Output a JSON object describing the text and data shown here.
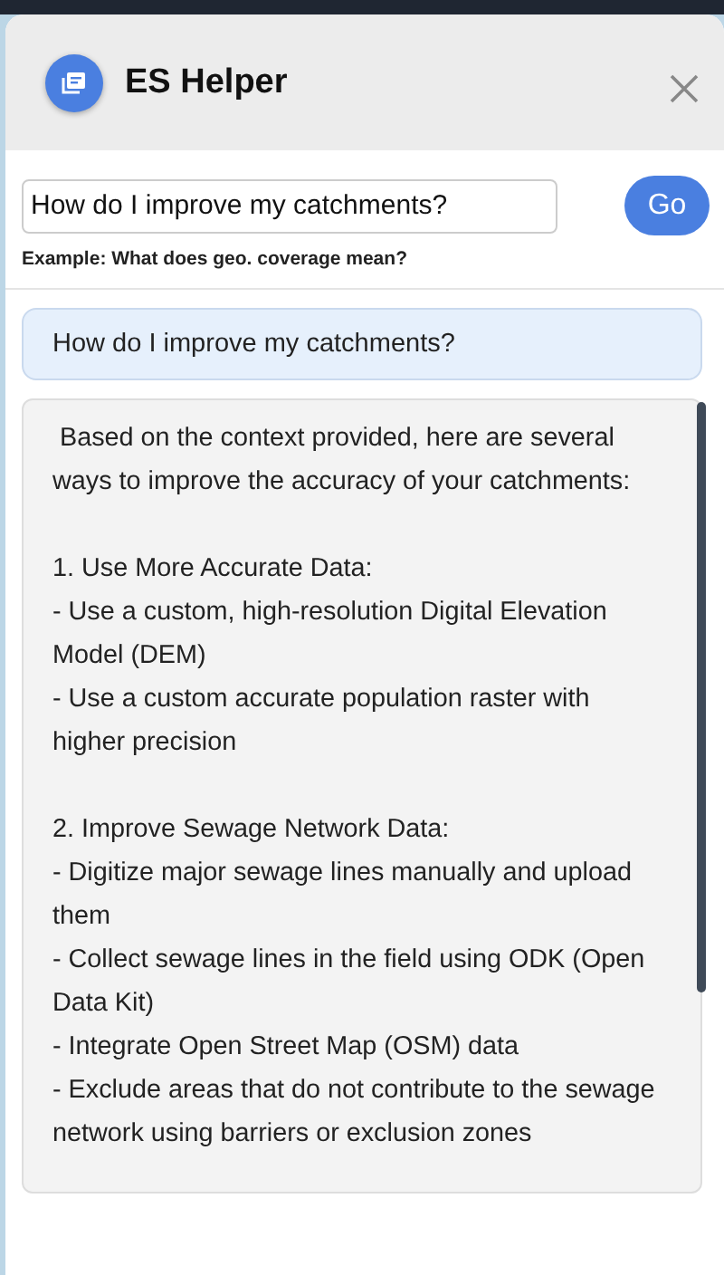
{
  "header": {
    "title": "ES Helper"
  },
  "query": {
    "value": "How do I improve my catchments?",
    "button": "Go",
    "hint": "Example: What does geo. coverage mean?"
  },
  "messages": [
    {
      "kind": "question",
      "text": "How do I improve my catchments?"
    },
    {
      "kind": "answer",
      "text": " Based on the context provided, here are several ways to improve the accuracy of your catchments:\n\n1. Use More Accurate Data:\n- Use a custom, high-resolution Digital Elevation Model (DEM)\n- Use a custom accurate population raster with higher precision\n\n2. Improve Sewage Network Data:\n- Digitize major sewage lines manually and upload them\n- Collect sewage lines in the field using ODK (Open Data Kit)\n- Integrate Open Street Map (OSM) data\n- Exclude areas that do not contribute to the sewage network using barriers or exclusion zones"
    }
  ]
}
